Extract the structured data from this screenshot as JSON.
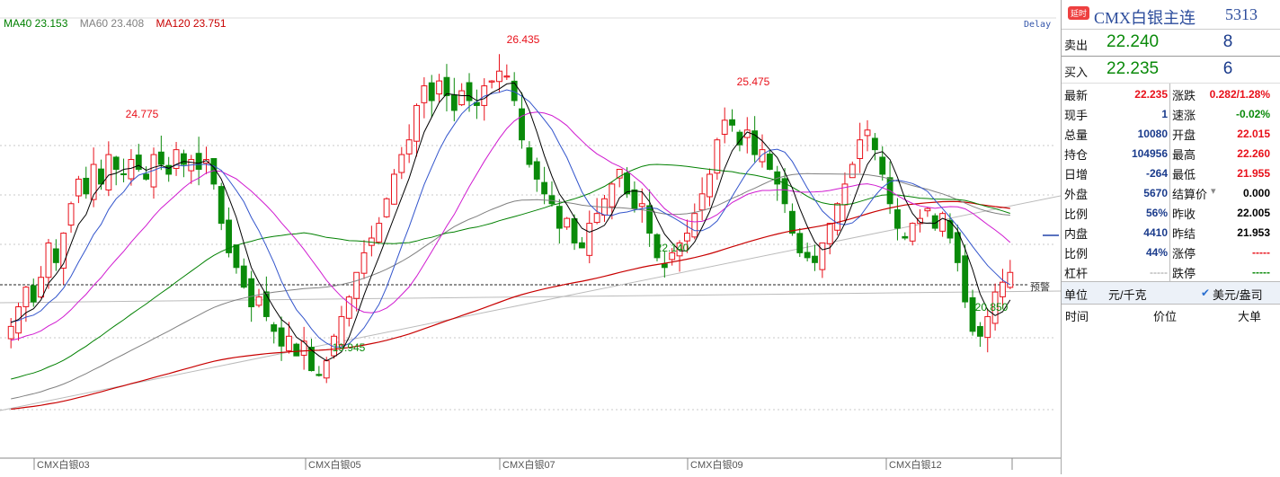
{
  "chart": {
    "ma_legend": [
      {
        "label": "MA40 23.153",
        "color": "#008000"
      },
      {
        "label": "MA60 23.408",
        "color": "#808080"
      },
      {
        "label": "MA120 23.751",
        "color": "#c80000"
      }
    ],
    "delay_label": "Delay",
    "warn_label": "预警",
    "annotations": {
      "high1": "24.775",
      "low1": "19.945",
      "high2": "26.435",
      "low2": "22.140",
      "high3": "25.475",
      "low3": "20.850"
    },
    "x_labels": [
      "CMX白银03",
      "CMX白银05",
      "CMX白银07",
      "CMX白银09",
      "CMX白银12"
    ],
    "colors": {
      "up": "#e8101a",
      "down": "#0a8a0a",
      "ma5": "#000000",
      "ma10": "#3355cc",
      "ma20": "#d01ad0",
      "ma40": "#008000",
      "ma60": "#808080",
      "ma120": "#c80000"
    }
  },
  "chart_data": {
    "type": "candlestick",
    "symbol": "CMX白银主连",
    "labeled_points": [
      {
        "label": "24.775",
        "kind": "high"
      },
      {
        "label": "19.945",
        "kind": "low"
      },
      {
        "label": "26.435",
        "kind": "high"
      },
      {
        "label": "22.140",
        "kind": "low"
      },
      {
        "label": "25.475",
        "kind": "high"
      },
      {
        "label": "20.850",
        "kind": "low"
      }
    ],
    "closes": [
      21.1,
      21.5,
      21.9,
      21.6,
      22.1,
      22.8,
      22.4,
      23.0,
      23.6,
      24.1,
      23.8,
      24.4,
      24.0,
      24.6,
      24.3,
      24.2,
      24.5,
      24.3,
      24.1,
      24.6,
      24.4,
      24.2,
      24.7,
      24.4,
      24.5,
      24.3,
      24.5,
      24.0,
      23.2,
      22.6,
      22.3,
      21.9,
      21.5,
      21.7,
      21.3,
      21.0,
      20.7,
      20.9,
      20.5,
      20.8,
      20.2,
      20.1,
      20.4,
      20.9,
      21.3,
      21.7,
      22.2,
      22.6,
      22.9,
      23.2,
      23.7,
      24.2,
      24.6,
      24.9,
      25.6,
      26.0,
      25.7,
      26.1,
      25.8,
      25.5,
      25.9,
      25.7,
      25.6,
      26.0,
      26.1,
      26.3,
      26.2,
      25.7,
      24.9,
      24.4,
      24.1,
      23.8,
      23.6,
      23.1,
      23.3,
      22.8,
      22.7,
      23.2,
      23.4,
      23.7,
      24.0,
      24.3,
      23.8,
      23.5,
      23.6,
      23.0,
      22.5,
      22.3,
      22.6,
      22.8,
      23.0,
      23.4,
      23.8,
      24.2,
      24.9,
      25.3,
      25.2,
      24.8,
      25.1,
      24.6,
      24.7,
      24.3,
      24.0,
      23.6,
      23.0,
      22.6,
      22.5,
      22.4,
      22.8,
      23.2,
      23.6,
      24.0,
      24.4,
      24.9,
      25.1,
      24.7,
      24.2,
      23.6,
      23.1,
      22.9,
      23.2,
      23.3,
      23.5,
      23.1,
      23.4,
      22.9,
      22.4,
      21.6,
      21.0,
      20.9,
      21.3,
      21.8,
      22.0,
      22.2
    ],
    "moving_averages": [
      {
        "name": "MA40",
        "value": 23.153
      },
      {
        "name": "MA60",
        "value": 23.408
      },
      {
        "name": "MA120",
        "value": 23.751
      }
    ]
  },
  "quote": {
    "badge": "延时",
    "title": "CMX白银主连",
    "code": "5313",
    "ask_label": "卖出",
    "ask_price": "22.240",
    "ask_vol": "8",
    "bid_label": "买入",
    "bid_price": "22.235",
    "bid_vol": "6",
    "rows": [
      {
        "l_label": "最新",
        "l_val": "22.235",
        "l_color": "red",
        "r_label": "涨跌",
        "r_val": "0.282/1.28%",
        "r_color": "red"
      },
      {
        "l_label": "现手",
        "l_val": "1",
        "l_color": "blue",
        "r_label": "速涨",
        "r_val": "-0.02%",
        "r_color": "green"
      },
      {
        "l_label": "总量",
        "l_val": "10080",
        "l_color": "blue",
        "r_label": "开盘",
        "r_val": "22.015",
        "r_color": "red"
      },
      {
        "l_label": "持仓",
        "l_val": "104956",
        "l_color": "blue",
        "r_label": "最高",
        "r_val": "22.260",
        "r_color": "red"
      },
      {
        "l_label": "日增",
        "l_val": "-264",
        "l_color": "blue",
        "r_label": "最低",
        "r_val": "21.955",
        "r_color": "red"
      },
      {
        "l_label": "外盘",
        "l_val": "5670",
        "l_color": "blue",
        "r_label": "结算价",
        "r_val": "0.000",
        "r_color": "black"
      },
      {
        "l_label": "比例",
        "l_val": "56%",
        "l_color": "blue",
        "r_label": "昨收",
        "r_val": "22.005",
        "r_color": "black"
      },
      {
        "l_label": "内盘",
        "l_val": "4410",
        "l_color": "blue",
        "r_label": "昨结",
        "r_val": "21.953",
        "r_color": "black"
      },
      {
        "l_label": "比例",
        "l_val": "44%",
        "l_color": "blue",
        "r_label": "涨停",
        "r_val": "-----",
        "r_color": "red"
      },
      {
        "l_label": "杠杆",
        "l_val": "-----",
        "l_color": "muted",
        "r_label": "跌停",
        "r_val": "-----",
        "r_color": "green"
      }
    ],
    "units_label": "单位",
    "units_value": "元/千克",
    "units_option": "美元/盎司",
    "tape_time": "时间",
    "tape_price": "价位",
    "tape_size": "大单"
  }
}
